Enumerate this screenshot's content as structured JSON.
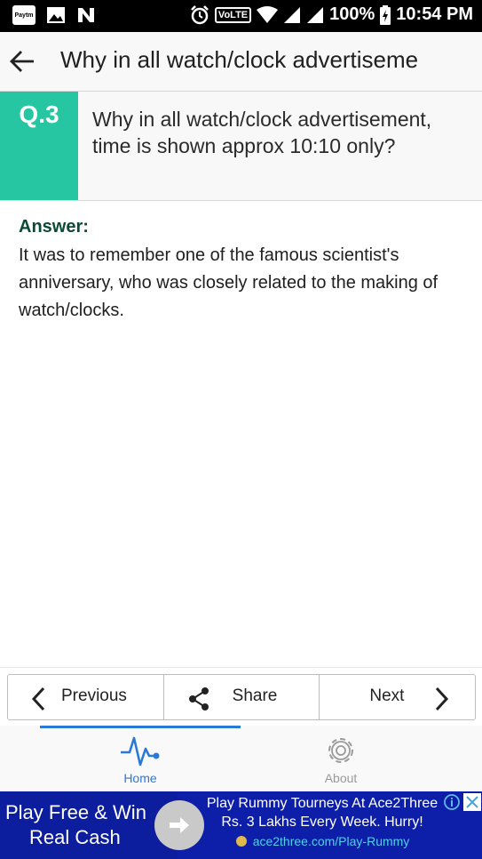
{
  "status_bar": {
    "paytm": "Paytm",
    "volte": "VoLTE",
    "battery": "100%",
    "time": "10:54 PM"
  },
  "app_bar": {
    "title": "Why in all watch/clock advertiseme"
  },
  "question": {
    "number": "Q.3",
    "text": "Why in all watch/clock advertisement, time is shown approx 10:10 only?"
  },
  "answer": {
    "label": "Answer:",
    "text": "It was to remember one of the famous scientist's anniversary, who was closely related to the making of watch/clocks."
  },
  "nav": {
    "previous": "Previous",
    "share": "Share",
    "next": "Next"
  },
  "tabs": [
    {
      "label": "Home",
      "icon": "pulse-icon",
      "active": true
    },
    {
      "label": "About",
      "icon": "gear-icon",
      "active": false
    }
  ],
  "ad": {
    "left_line1": "Play Free & Win",
    "left_line2": "Real Cash",
    "headline1": "Play Rummy Tourneys At Ace2Three",
    "headline2": "Rs. 3 Lakhs Every Week. Hurry!",
    "url": "ace2three.com/Play-Rummy"
  },
  "colors": {
    "accent_teal": "#26c6a2",
    "tab_active": "#2a79d8",
    "tab_inactive": "#9a9a9a",
    "answer_label": "#0b4a33",
    "ad_background": "#0d1fa8"
  }
}
